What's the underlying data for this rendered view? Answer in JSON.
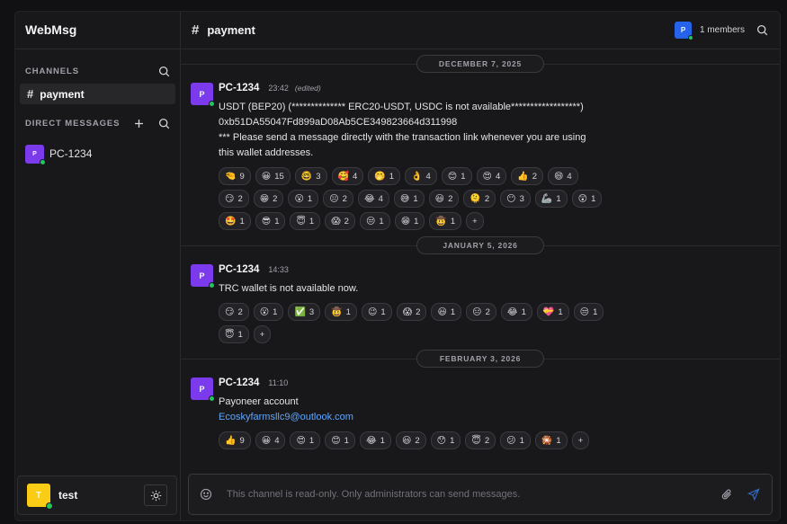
{
  "app": {
    "brand": "WebMsg"
  },
  "sidebar": {
    "channels_title": "CHANNELS",
    "channels": [
      {
        "hash": "#",
        "label": "payment"
      }
    ],
    "dm_title": "DIRECT MESSAGES",
    "dms": [
      {
        "avatar": "P",
        "label": "PC-1234"
      }
    ],
    "user": {
      "avatar": "T",
      "name": "test"
    }
  },
  "header": {
    "hash": "#",
    "title": "payment",
    "member_avatar": "P",
    "members": "1 members"
  },
  "feed": {
    "groups": [
      {
        "date": "DECEMBER 7, 2025",
        "message": {
          "avatar": "P",
          "author": "PC-1234",
          "time": "23:42",
          "edited": "(edited)",
          "lines": [
            "USDT (BEP20) (************** ERC20-USDT, USDC is not available******************)",
            "0xb51DA55047Fd899aD08Ab5CE349823664d311998",
            "*** Please send a message directly with the transaction link whenever you are using",
            "this wallet addresses."
          ],
          "reactions": [
            {
              "e": "🤏",
              "n": "9"
            },
            {
              "e": "😀",
              "n": "15"
            },
            {
              "e": "🤓",
              "n": "3"
            },
            {
              "e": "🥰",
              "n": "4"
            },
            {
              "e": "🤭",
              "n": "1"
            },
            {
              "e": "👌",
              "n": "4"
            },
            {
              "e": "😊",
              "n": "1"
            },
            {
              "e": "😍",
              "n": "4"
            },
            {
              "e": "👍",
              "n": "2"
            },
            {
              "e": "😄",
              "n": "4"
            },
            {
              "e": "😏",
              "n": "2"
            },
            {
              "e": "😁",
              "n": "2"
            },
            {
              "e": "😮",
              "n": "1"
            },
            {
              "e": "😐",
              "n": "2"
            },
            {
              "e": "😂",
              "n": "4"
            },
            {
              "e": "😅",
              "n": "1"
            },
            {
              "e": "😃",
              "n": "2"
            },
            {
              "e": "🫠",
              "n": "2"
            },
            {
              "e": "😶",
              "n": "3"
            },
            {
              "e": "🦾",
              "n": "1"
            },
            {
              "e": "😲",
              "n": "1"
            },
            {
              "e": "🤩",
              "n": "1"
            },
            {
              "e": "😎",
              "n": "1"
            },
            {
              "e": "😇",
              "n": "1"
            },
            {
              "e": "😱",
              "n": "2"
            },
            {
              "e": "😒",
              "n": "1"
            },
            {
              "e": "😁",
              "n": "1"
            },
            {
              "e": "🤠",
              "n": "1"
            }
          ],
          "add": "+"
        }
      },
      {
        "date": "JANUARY 5, 2026",
        "message": {
          "avatar": "P",
          "author": "PC-1234",
          "time": "14:33",
          "lines": [
            "TRC wallet is not available now."
          ],
          "reactions": [
            {
              "e": "😏",
              "n": "2"
            },
            {
              "e": "😮",
              "n": "1"
            },
            {
              "e": "✅",
              "n": "3"
            },
            {
              "e": "🤠",
              "n": "1"
            },
            {
              "e": "😉",
              "n": "1"
            },
            {
              "e": "😱",
              "n": "2"
            },
            {
              "e": "😃",
              "n": "1"
            },
            {
              "e": "😑",
              "n": "2"
            },
            {
              "e": "😂",
              "n": "1"
            },
            {
              "e": "💝",
              "n": "1"
            },
            {
              "e": "😒",
              "n": "1"
            },
            {
              "e": "😇",
              "n": "1"
            }
          ],
          "add": "+"
        }
      },
      {
        "date": "FEBRUARY 3, 2026",
        "message": {
          "avatar": "P",
          "author": "PC-1234",
          "time": "11:10",
          "lines": [
            "Payoneer account"
          ],
          "link": "Ecoskyfarmsllc9@outlook.com",
          "reactions": [
            {
              "e": "👍",
              "n": "9"
            },
            {
              "e": "😀",
              "n": "4"
            },
            {
              "e": "😍",
              "n": "1"
            },
            {
              "e": "😊",
              "n": "1"
            },
            {
              "e": "😂",
              "n": "1"
            },
            {
              "e": "😃",
              "n": "2"
            },
            {
              "e": "😯",
              "n": "1"
            },
            {
              "e": "😇",
              "n": "2"
            },
            {
              "e": "😕",
              "n": "1"
            },
            {
              "e": "🎇",
              "n": "1"
            }
          ],
          "add": "+"
        }
      }
    ]
  },
  "composer": {
    "placeholder": "This channel is read-only. Only administrators can send messages."
  },
  "icons": {
    "search": "search-icon",
    "plus": "plus-icon",
    "sun": "sun-icon",
    "smile": "smile-icon",
    "paperclip": "paperclip-icon",
    "send": "send-icon"
  }
}
